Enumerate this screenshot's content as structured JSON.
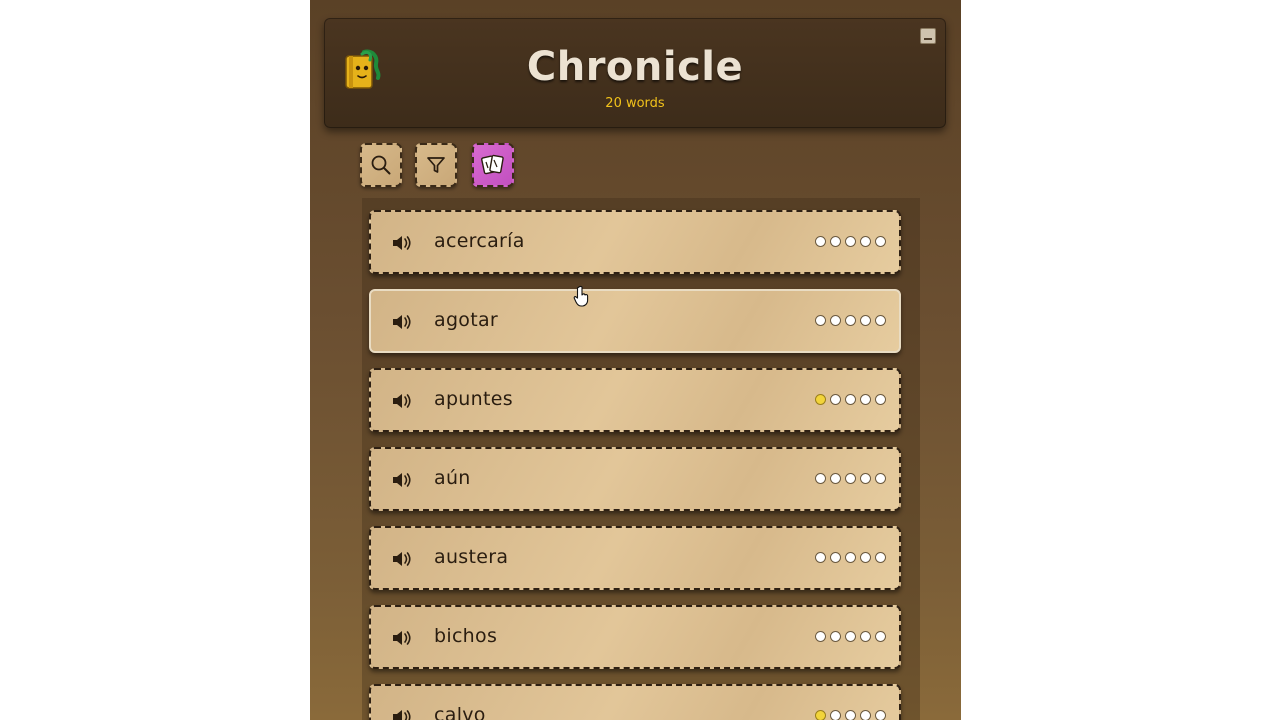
{
  "app": {
    "title": "Chronicle",
    "subtitle": "20 words",
    "mascot_icon": "book-mascot-icon"
  },
  "toolbar": [
    {
      "name": "search-button",
      "icon": "search-icon"
    },
    {
      "name": "filter-button",
      "icon": "filter-icon"
    },
    {
      "name": "flashcards-button",
      "icon": "cards-icon",
      "active": true
    }
  ],
  "words": [
    {
      "text": "acercaría",
      "progress": 0
    },
    {
      "text": "agotar",
      "progress": 0
    },
    {
      "text": "apuntes",
      "progress": 1
    },
    {
      "text": "aún",
      "progress": 0
    },
    {
      "text": "austera",
      "progress": 0
    },
    {
      "text": "bichos",
      "progress": 0
    },
    {
      "text": "calvo",
      "progress": 1
    }
  ],
  "progress_max": 5,
  "colors": {
    "accent": "#f1c21b",
    "active_tool": "#d35fcc",
    "card": "#dcc091",
    "header": "#3d2c1a"
  }
}
